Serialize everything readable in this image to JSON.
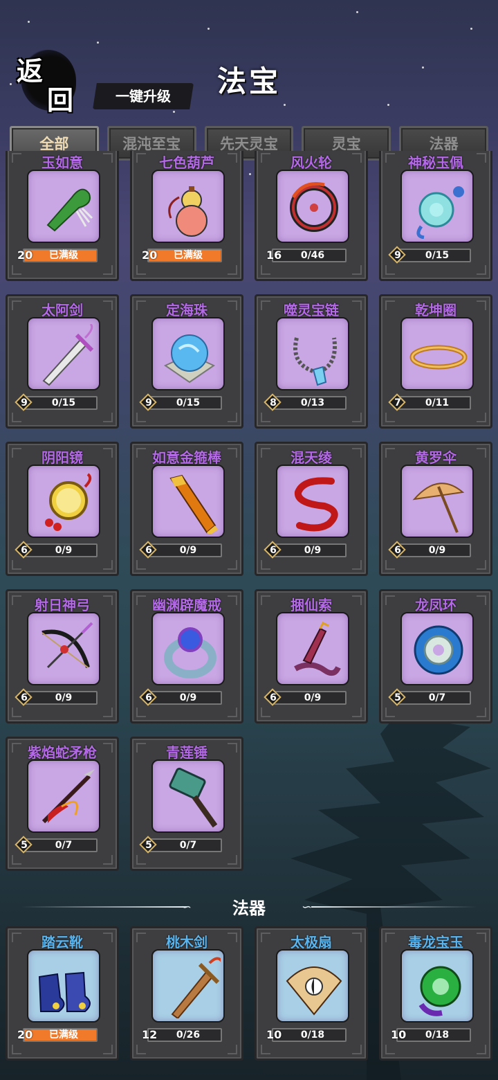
{
  "header": {
    "back": [
      "返",
      "回"
    ],
    "title": "法宝",
    "upgrade_all": "一键升级"
  },
  "tabs": [
    {
      "label": "全部",
      "active": true
    },
    {
      "label": "混沌至宝",
      "active": false
    },
    {
      "label": "先天灵宝",
      "active": false
    },
    {
      "label": "灵宝",
      "active": false
    },
    {
      "label": "法器",
      "active": false
    }
  ],
  "treasures": [
    {
      "name": "玉如意",
      "level": "20",
      "progress": "已满级",
      "fill": 1.0,
      "icon": "jade-ruyi-icon"
    },
    {
      "name": "七色葫芦",
      "level": "20",
      "progress": "已满级",
      "fill": 1.0,
      "icon": "gourd-icon"
    },
    {
      "name": "风火轮",
      "level": "16",
      "progress": "0/46",
      "fill": 0,
      "icon": "wind-fire-wheel-icon"
    },
    {
      "name": "神秘玉佩",
      "level": "9",
      "progress": "0/15",
      "fill": 0,
      "icon": "jade-pendant-icon"
    },
    {
      "name": "太阿剑",
      "level": "9",
      "progress": "0/15",
      "fill": 0,
      "icon": "sword-icon"
    },
    {
      "name": "定海珠",
      "level": "9",
      "progress": "0/15",
      "fill": 0,
      "icon": "pearl-icon"
    },
    {
      "name": "噬灵宝链",
      "level": "8",
      "progress": "0/13",
      "fill": 0,
      "icon": "necklace-icon"
    },
    {
      "name": "乾坤圈",
      "level": "7",
      "progress": "0/11",
      "fill": 0,
      "icon": "golden-ring-icon"
    },
    {
      "name": "阴阳镜",
      "level": "6",
      "progress": "0/9",
      "fill": 0,
      "icon": "mirror-icon"
    },
    {
      "name": "如意金箍棒",
      "level": "6",
      "progress": "0/9",
      "fill": 0,
      "icon": "golden-staff-icon"
    },
    {
      "name": "混天绫",
      "level": "6",
      "progress": "0/9",
      "fill": 0,
      "icon": "red-sash-icon"
    },
    {
      "name": "黄罗伞",
      "level": "6",
      "progress": "0/9",
      "fill": 0,
      "icon": "umbrella-icon"
    },
    {
      "name": "射日神弓",
      "level": "6",
      "progress": "0/9",
      "fill": 0,
      "icon": "bow-icon"
    },
    {
      "name": "幽渊辟魔戒",
      "level": "6",
      "progress": "0/9",
      "fill": 0,
      "icon": "ring-icon"
    },
    {
      "name": "捆仙索",
      "level": "6",
      "progress": "0/9",
      "fill": 0,
      "icon": "rope-icon"
    },
    {
      "name": "龙凤环",
      "level": "5",
      "progress": "0/7",
      "fill": 0,
      "icon": "dragon-phoenix-ring-icon"
    },
    {
      "name": "紫焰蛇矛枪",
      "level": "5",
      "progress": "0/7",
      "fill": 0,
      "icon": "spear-icon"
    },
    {
      "name": "青莲锤",
      "level": "5",
      "progress": "0/7",
      "fill": 0,
      "icon": "hammer-icon"
    }
  ],
  "section_title": "法器",
  "artifacts": [
    {
      "name": "踏云靴",
      "level": "20",
      "progress": "已满级",
      "fill": 1.0,
      "icon": "boots-icon"
    },
    {
      "name": "桃木剑",
      "level": "12",
      "progress": "0/26",
      "fill": 0,
      "icon": "wooden-sword-icon"
    },
    {
      "name": "太极扇",
      "level": "10",
      "progress": "0/18",
      "fill": 0,
      "icon": "fan-icon"
    },
    {
      "name": "毒龙宝玉",
      "level": "10",
      "progress": "0/18",
      "fill": 0,
      "icon": "poison-jade-icon"
    }
  ]
}
